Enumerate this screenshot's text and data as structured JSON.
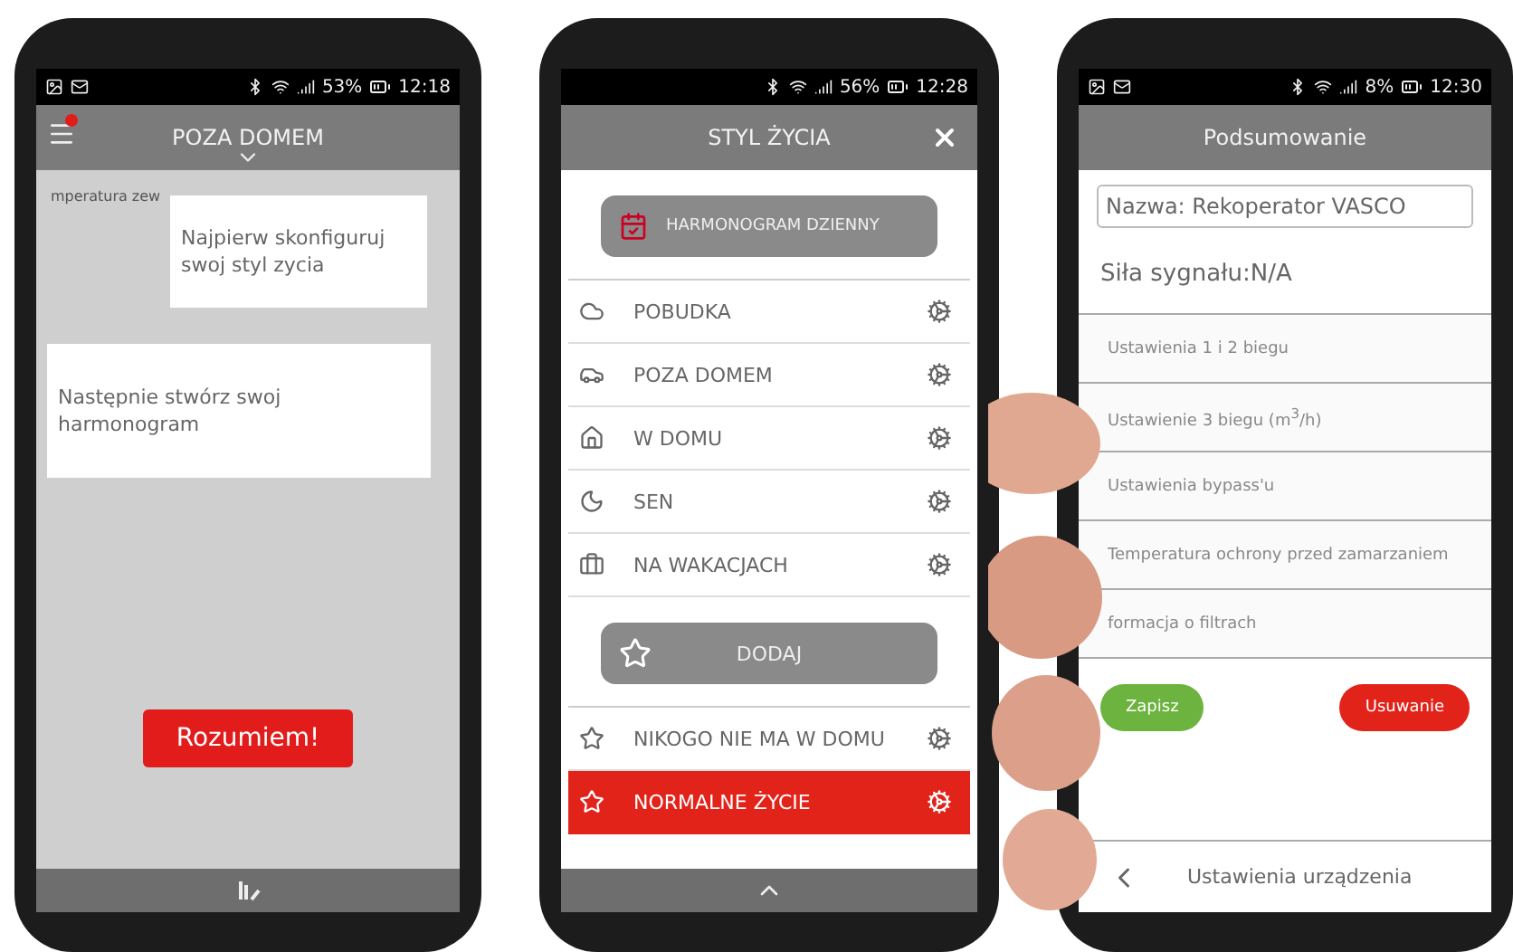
{
  "tutorial_screen": {
    "status_bar": {
      "battery": "53%",
      "time": "12:18"
    },
    "header": {
      "title": "POZA DOMEM",
      "has_notification": true
    },
    "background_label": "mperatura zew",
    "tooltips": [
      "Najpierw skonfiguruj swoj styl zycia",
      "Następnie stwórz swoj harmonogram"
    ],
    "button": "Rozumiem!"
  },
  "lifestyle_screen": {
    "status_bar": {
      "battery": "56%",
      "time": "12:28"
    },
    "header": {
      "title": "STYL ŻYCIA"
    },
    "schedule_button": "HARMONOGRAM DZIENNY",
    "modes": [
      {
        "kind": "cloud",
        "label": "POBUDKA",
        "selected": false
      },
      {
        "kind": "car",
        "label": "POZA DOMEM",
        "selected": false
      },
      {
        "kind": "home",
        "label": "W DOMU",
        "selected": false
      },
      {
        "kind": "moon",
        "label": "SEN",
        "selected": false
      },
      {
        "kind": "suitcase",
        "label": "NA WAKACJACH",
        "selected": false
      }
    ],
    "add_button": "DODAJ",
    "custom_modes": [
      {
        "kind": "star",
        "label": "NIKOGO NIE MA W DOMU",
        "selected": false
      },
      {
        "kind": "star",
        "label": "NORMALNE ŻYCIE",
        "selected": true
      }
    ]
  },
  "summary_screen": {
    "status_bar": {
      "battery": "8%",
      "time": "12:30"
    },
    "header": {
      "title": "Podsumowanie"
    },
    "name_field": {
      "value": "Nazwa: Rekoperator VASCO"
    },
    "signal": "Siła sygnału:N/A",
    "rows": [
      "Ustawienia 1 i 2 biegu",
      "Ustawienie 3 biegu (m$^{3}$/h)",
      "Ustawienia bypass'u",
      "Temperatura ochrony przed zamarzaniem",
      "formacja o filtrach"
    ],
    "buttons": [
      {
        "kind": "save",
        "label": "Zapisz"
      },
      {
        "kind": "delete",
        "label": "Usuwanie"
      }
    ],
    "footer": "Ustawienia urządzenia"
  }
}
